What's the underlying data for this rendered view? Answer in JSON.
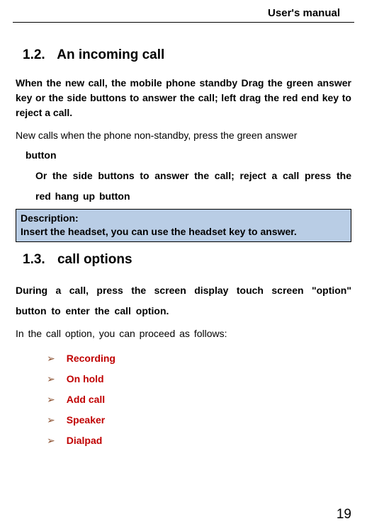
{
  "header": {
    "title": "User's manual"
  },
  "section1": {
    "number": "1.2.",
    "title": "An  incoming  call",
    "para1": "When the  new  call, the mobile phone standby Drag  the green answer  key or the  side  buttons to  answer  the  call; left drag the red end  key to reject  a  call.",
    "para2": "New calls when the phone non-standby, press  the  green answer",
    "para3": "button",
    "para4": "Or  the  side  buttons  to  answer  the  call;  reject  a  call  press  the  red  hang  up  button"
  },
  "description": {
    "label": "Description:",
    "text": "Insert the headset,  you  can  use the headset key  to  answer."
  },
  "section2": {
    "number": "1.3.",
    "title": "call options",
    "para1": "During  a  call,  press  the  screen  display  touch  screen  \"option\"  button  to  enter  the  call  option.",
    "para2": "In the call option,  you  can proceed  as  follows:",
    "bullets": [
      " Recording",
      "On  hold",
      "Add  call",
      "Speaker",
      "Dialpad"
    ]
  },
  "page": {
    "number": "19"
  }
}
